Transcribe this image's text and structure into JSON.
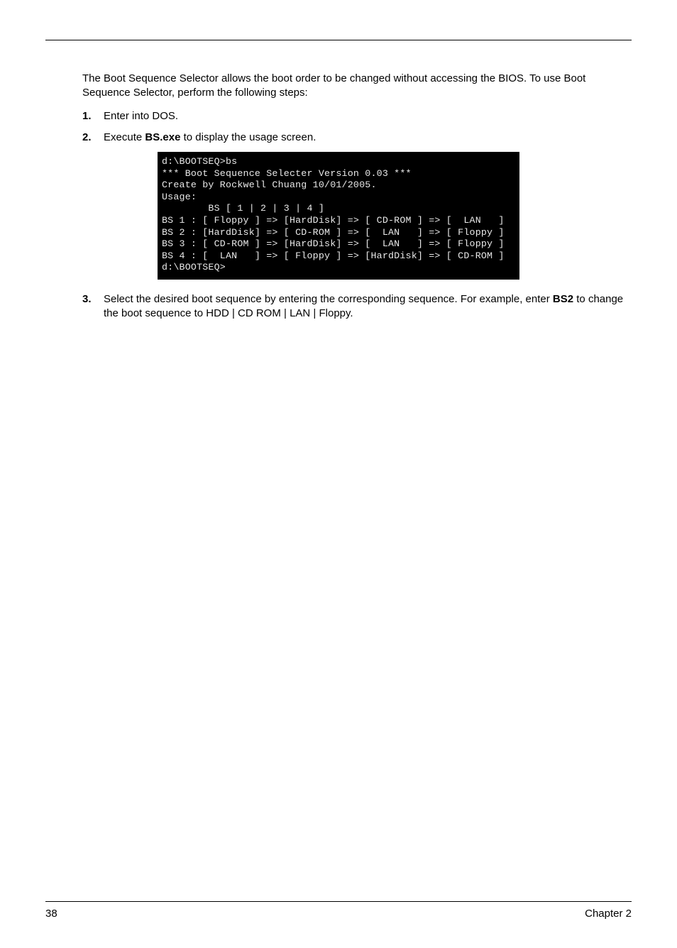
{
  "intro": "The Boot Sequence Selector allows the boot order to be changed without accessing the BIOS. To use Boot Sequence Selector, perform the following steps:",
  "steps": {
    "1": {
      "num": "1.",
      "text": "Enter into DOS."
    },
    "2": {
      "num": "2.",
      "prefix": "Execute ",
      "bold": "BS.exe",
      "suffix": " to display the usage screen."
    },
    "3": {
      "num": "3.",
      "prefix": "Select the desired boot sequence by entering the corresponding sequence. For example, enter ",
      "bold": "BS2",
      "suffix": " to change the boot sequence to HDD | CD ROM | LAN | Floppy."
    }
  },
  "terminal": {
    "l01": "d:\\BOOTSEQ>bs",
    "l02": "",
    "l03": "*** Boot Sequence Selecter Version 0.03 ***",
    "l04": "Create by Rockwell Chuang 10/01/2005.",
    "l05": "",
    "l06": "Usage:",
    "l07": "        BS [ 1 | 2 | 3 | 4 ]",
    "l08": "",
    "l09": "BS 1 : [ Floppy ] => [HardDisk] => [ CD-ROM ] => [  LAN   ]",
    "l10": "BS 2 : [HardDisk] => [ CD-ROM ] => [  LAN   ] => [ Floppy ]",
    "l11": "BS 3 : [ CD-ROM ] => [HardDisk] => [  LAN   ] => [ Floppy ]",
    "l12": "BS 4 : [  LAN   ] => [ Floppy ] => [HardDisk] => [ CD-ROM ]",
    "l13": "",
    "l14": "d:\\BOOTSEQ>"
  },
  "footer": {
    "page": "38",
    "chapter": "Chapter 2"
  }
}
